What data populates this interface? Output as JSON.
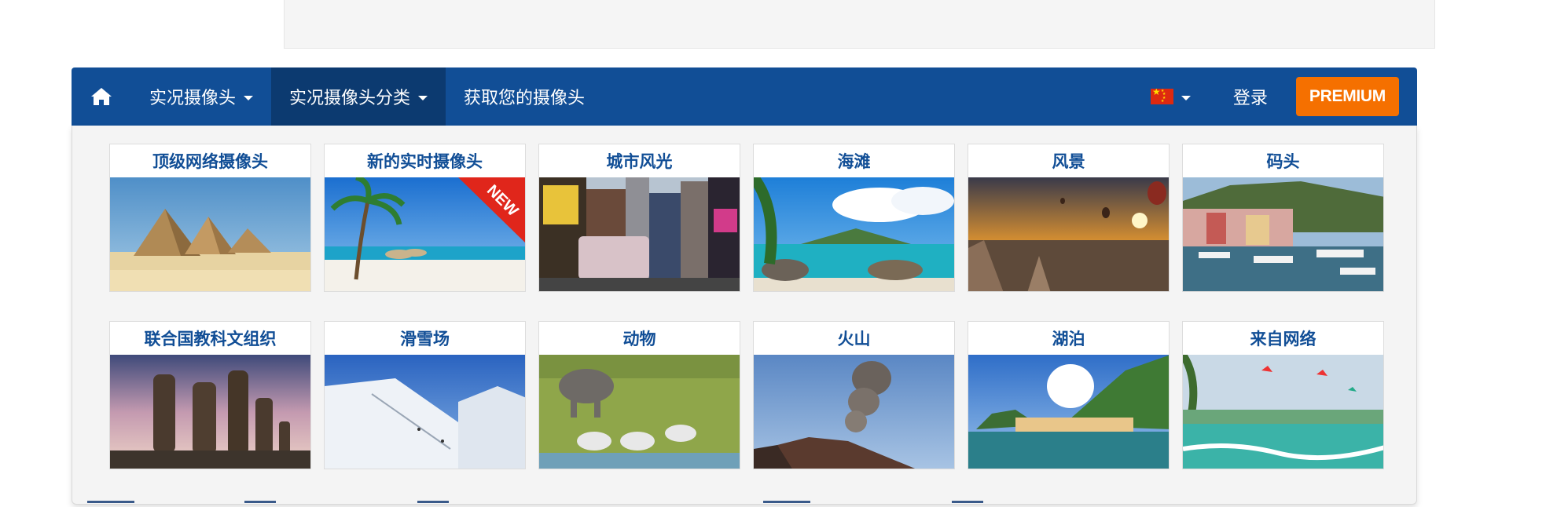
{
  "nav": {
    "items": [
      {
        "label": "实况摄像头",
        "active": false
      },
      {
        "label": "实况摄像头分类",
        "active": true
      },
      {
        "label": "获取您的摄像头",
        "active": false
      }
    ],
    "language_flag": "chinese-flag",
    "login_label": "登录",
    "premium_label": "PREMIUM"
  },
  "categories": [
    {
      "title": "顶级网络摄像头"
    },
    {
      "title": "新的实时摄像头",
      "badge": "NEW"
    },
    {
      "title": "城市风光"
    },
    {
      "title": "海滩"
    },
    {
      "title": "风景"
    },
    {
      "title": "码头"
    },
    {
      "title": "联合国教科文组织"
    },
    {
      "title": "滑雪场"
    },
    {
      "title": "动物"
    },
    {
      "title": "火山"
    },
    {
      "title": "湖泊"
    },
    {
      "title": "来自网络"
    }
  ],
  "colors": {
    "nav_bg": "#114e96",
    "nav_active_bg": "#0c3a70",
    "premium_bg": "#f57000",
    "tile_title": "#114e96"
  }
}
